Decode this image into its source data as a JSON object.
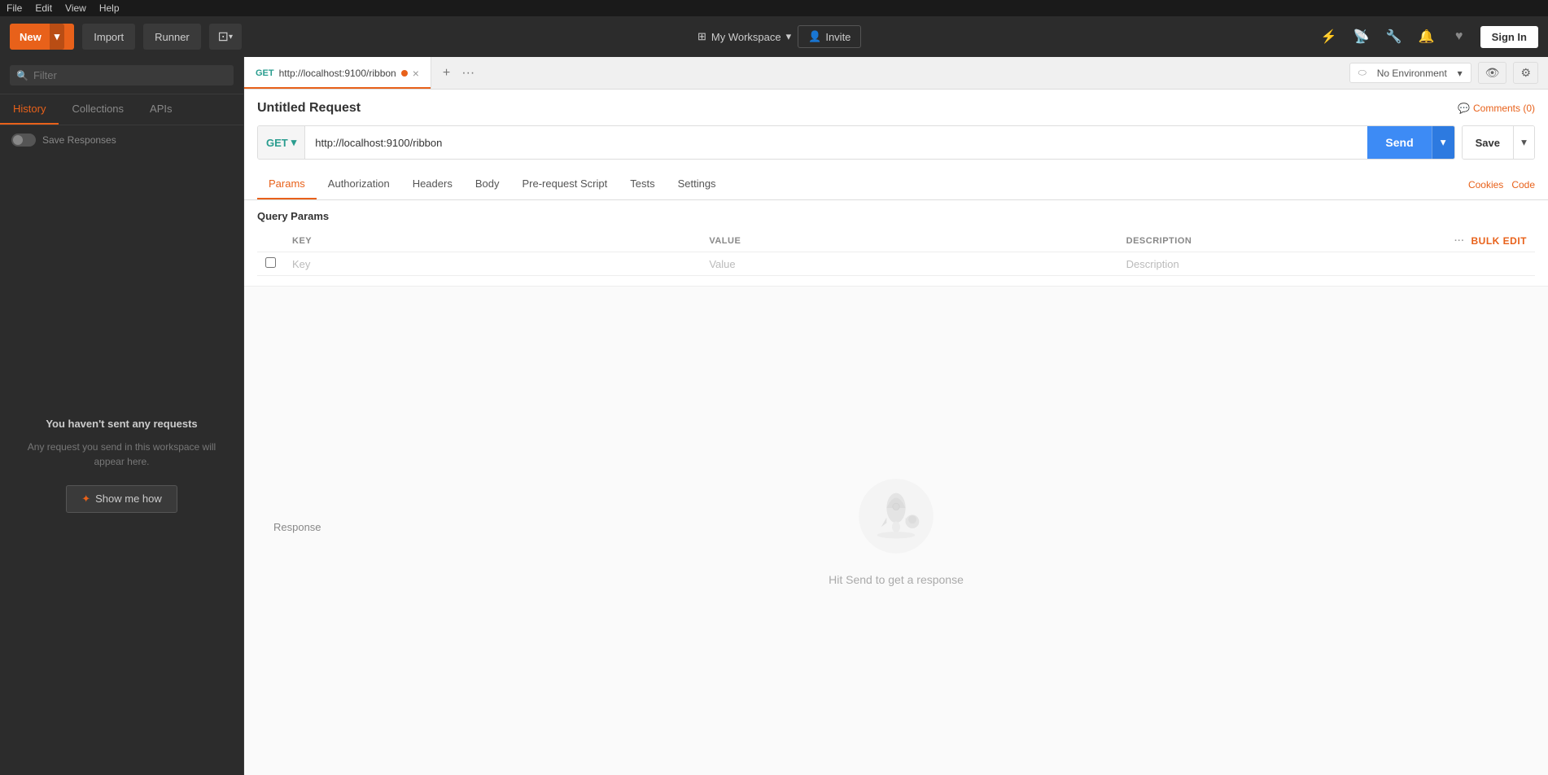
{
  "menu": {
    "items": [
      "File",
      "Edit",
      "View",
      "Help"
    ]
  },
  "toolbar": {
    "new_label": "New",
    "import_label": "Import",
    "runner_label": "Runner",
    "workspace_label": "My Workspace",
    "invite_label": "Invite",
    "sign_in_label": "Sign In"
  },
  "sidebar": {
    "search_placeholder": "Filter",
    "tabs": [
      "History",
      "Collections",
      "APIs"
    ],
    "active_tab": "History",
    "toggle_label": "Save Responses",
    "empty_title": "You haven't sent any requests",
    "empty_body": "Any request you send in this workspace will appear here.",
    "show_me_label": "Show me how"
  },
  "tab_bar": {
    "tab": {
      "method": "GET",
      "url": "http://localhost:9100/ribbon",
      "has_dot": true
    },
    "environment": {
      "label": "No Environment",
      "dropdown_arrow": "▾"
    }
  },
  "request": {
    "title": "Untitled Request",
    "comments_label": "Comments (0)",
    "method": "GET",
    "url": "http://localhost:9100/ribbon",
    "send_label": "Send",
    "save_label": "Save",
    "tabs": [
      "Params",
      "Authorization",
      "Headers",
      "Body",
      "Pre-request Script",
      "Tests",
      "Settings"
    ],
    "active_tab": "Params",
    "cookies_label": "Cookies",
    "code_label": "Code",
    "query_params_title": "Query Params",
    "table": {
      "headers": [
        "KEY",
        "VALUE",
        "DESCRIPTION"
      ],
      "key_placeholder": "Key",
      "value_placeholder": "Value",
      "description_placeholder": "Description",
      "bulk_edit_label": "Bulk Edit"
    }
  },
  "response": {
    "title": "Response",
    "hint": "Hit Send to get a response"
  },
  "icons": {
    "search": "🔍",
    "dropdown": "▾",
    "plus": "+",
    "more": "···",
    "close": "×",
    "eye": "👁",
    "gear": "⚙",
    "workspace_grid": "⊞",
    "user_plus": "👤+",
    "rocket": "🚀",
    "cursor": "✦",
    "comment": "💬",
    "lightning": "⚡"
  }
}
